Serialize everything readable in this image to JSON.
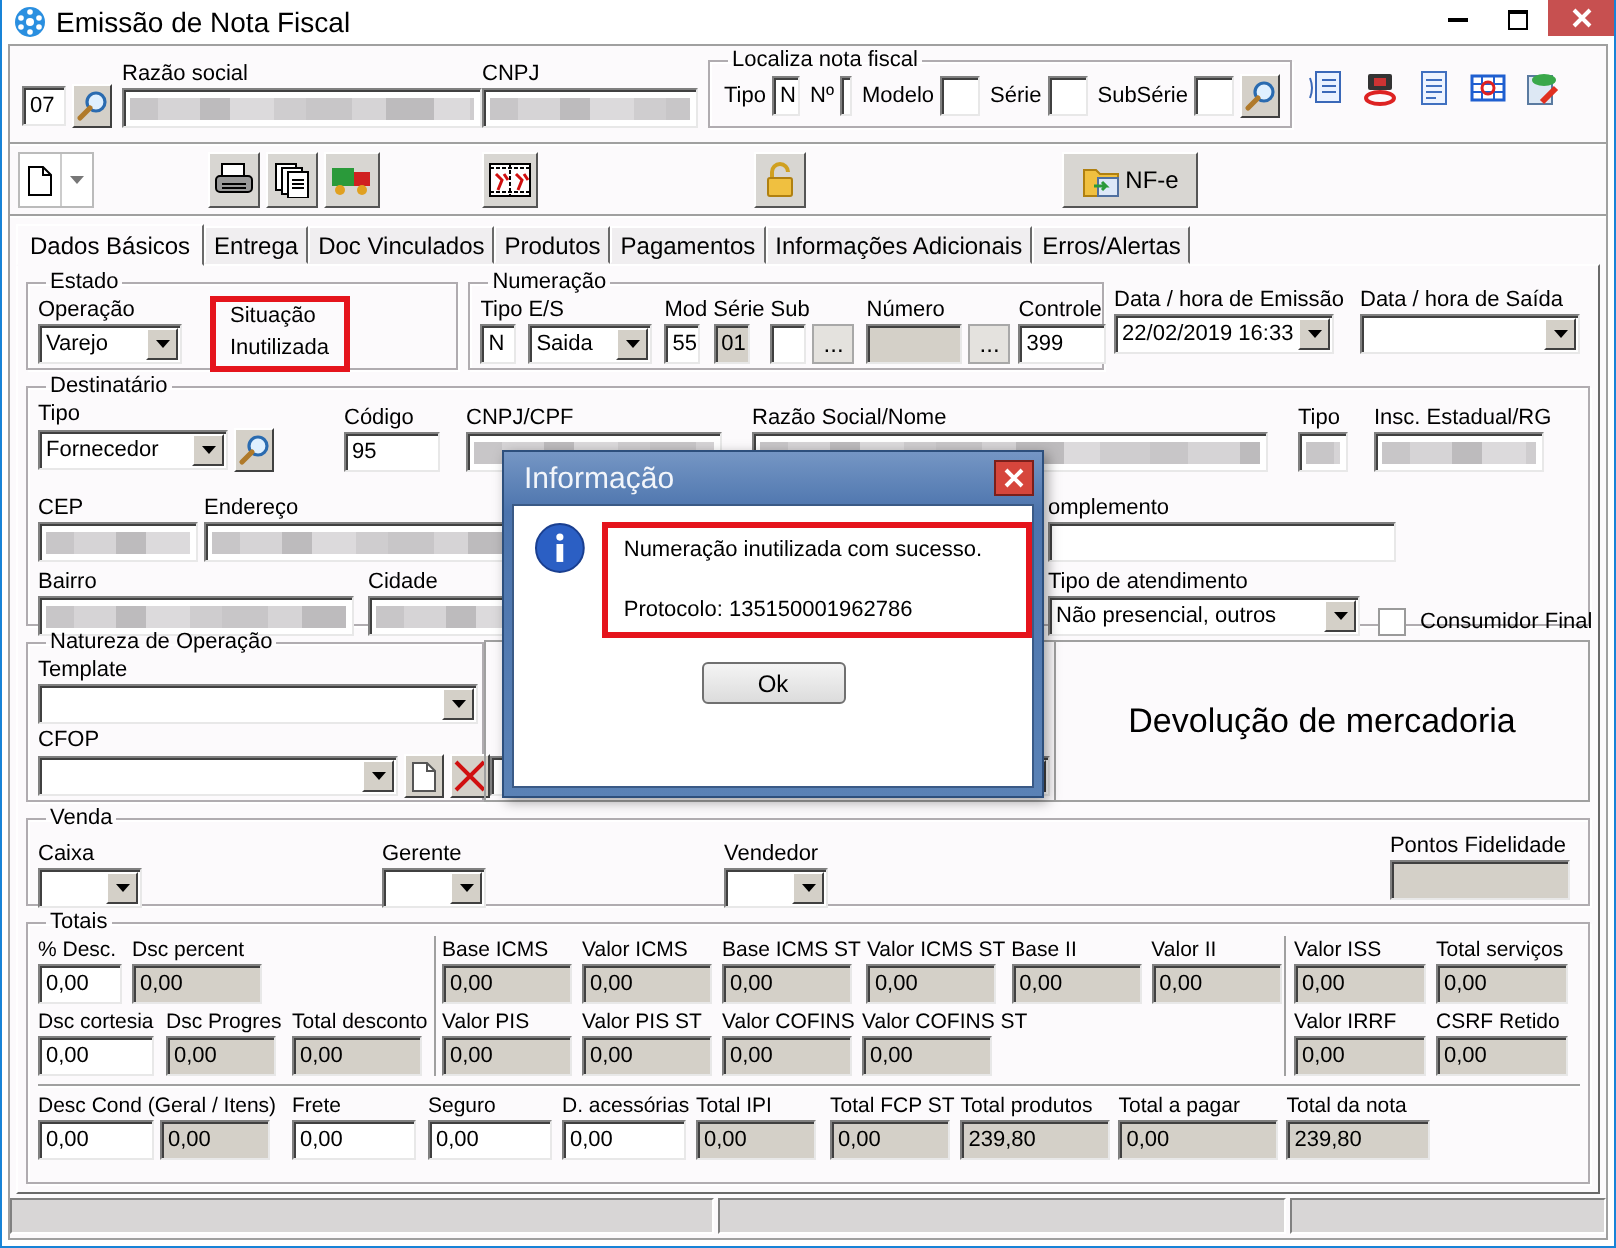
{
  "window": {
    "title": "Emissão de Nota Fiscal"
  },
  "header": {
    "fields": [
      {
        "value": "07",
        "search": true
      },
      {
        "label": "Razão social",
        "redacted": true
      },
      {
        "label": "CNPJ",
        "redacted": true
      }
    ]
  },
  "localiza": {
    "title": "Localiza nota fiscal",
    "fields": [
      {
        "label": "Tipo",
        "value": "N"
      },
      {
        "label": "Nº"
      },
      {
        "label": "Modelo"
      },
      {
        "label": "Série"
      },
      {
        "label": "SubSérie"
      }
    ]
  },
  "toolbar": {
    "nfe_label": "NF-e"
  },
  "tabs": [
    {
      "label": "Dados Básicos",
      "selected": true
    },
    {
      "label": "Entrega",
      "selected": false
    },
    {
      "label": "Doc Vinculados",
      "selected": false
    },
    {
      "label": "Produtos",
      "selected": false
    },
    {
      "label": "Pagamentos",
      "selected": false
    },
    {
      "label": "Informações Adicionais",
      "selected": false
    },
    {
      "label": "Erros/Alertas",
      "selected": false
    }
  ],
  "estado": {
    "title": "Estado",
    "operacao": {
      "label": "Operação",
      "value": "Varejo",
      "kind": "combo"
    },
    "situacao": {
      "label": "Situação",
      "value": "Inutilizada",
      "highlighted": true
    }
  },
  "numeracao": {
    "title": "Numeração",
    "fields": [
      {
        "label": "Tipo",
        "value": "N",
        "kind": "text",
        "disabled": false
      },
      {
        "label": "E/S",
        "value": "Saida",
        "kind": "combo",
        "disabled": false
      },
      {
        "label": "Mod",
        "value": "55",
        "kind": "text",
        "disabled": false
      },
      {
        "label": "Série",
        "value": "01",
        "kind": "text",
        "disabled": true
      },
      {
        "label": "Sub",
        "kind": "text",
        "disabled": false,
        "button": "..."
      },
      {
        "label": "Número",
        "kind": "text",
        "disabled": true,
        "button": "..."
      },
      {
        "label": "Controle",
        "value": "399",
        "kind": "text",
        "disabled": false
      }
    ]
  },
  "datas": [
    {
      "label": "Data / hora de Emissão",
      "value": "22/02/2019 16:33",
      "kind": "combo"
    },
    {
      "label": "Data / hora de Saída",
      "kind": "combo"
    }
  ],
  "destinatario": {
    "title": "Destinatário",
    "fields": [
      {
        "label": "Tipo",
        "value": "Fornecedor",
        "kind": "combo",
        "search": true
      },
      {
        "label": "Código",
        "value": "95",
        "kind": "text"
      },
      {
        "label": "CNPJ/CPF",
        "kind": "text",
        "redacted": true
      },
      {
        "label": "Razão Social/Nome",
        "kind": "text",
        "redacted": true
      },
      {
        "label": "Tipo",
        "kind": "text",
        "redacted": true
      },
      {
        "label": "Insc. Estadual/RG",
        "kind": "text",
        "redacted": true
      },
      {
        "label": "CEP",
        "kind": "text",
        "redacted": true
      },
      {
        "label": "Endereço",
        "kind": "text",
        "redacted": true
      },
      {
        "label": "omplemento",
        "kind": "text"
      },
      {
        "label": "Bairro",
        "kind": "text",
        "redacted": true
      },
      {
        "label": "Cidade",
        "kind": "text",
        "redacted": true
      },
      {
        "label": "Tipo de atendimento",
        "value": "Não presencial, outros",
        "kind": "combo"
      },
      {
        "label": "Consumidor Final",
        "kind": "check",
        "checked": false
      }
    ]
  },
  "natureza": {
    "title": "Natureza de Operação",
    "fields": [
      {
        "label": "Template",
        "kind": "combo"
      },
      {
        "label": "CFOP",
        "kind": "combo",
        "actions": true
      }
    ]
  },
  "operation_description": "Devolução de mercadoria",
  "venda": {
    "title": "Venda",
    "fields": [
      {
        "label": "Caixa",
        "kind": "combo",
        "disabled": false
      },
      {
        "label": "Gerente",
        "kind": "combo",
        "disabled": false
      },
      {
        "label": "Vendedor",
        "kind": "combo",
        "disabled": false
      },
      {
        "label": "Pontos Fidelidade",
        "kind": "text",
        "disabled": true
      }
    ]
  },
  "totais": {
    "title": "Totais",
    "left": [
      [
        {
          "label": "% Desc.",
          "value": "0,00",
          "disabled": false
        },
        {
          "label": "Dsc percent",
          "value": "0,00",
          "disabled": true
        }
      ],
      [
        {
          "label": "Dsc cortesia",
          "value": "0,00",
          "disabled": false
        },
        {
          "label": "Dsc Progres",
          "value": "0,00",
          "disabled": true
        },
        {
          "label": "Total desconto",
          "value": "0,00",
          "disabled": true
        }
      ]
    ],
    "middle": [
      [
        {
          "label": "Base ICMS",
          "value": "0,00",
          "disabled": true
        },
        {
          "label": "Valor ICMS",
          "value": "0,00",
          "disabled": true
        },
        {
          "label": "Base ICMS ST",
          "value": "0,00",
          "disabled": true
        },
        {
          "label": "Valor ICMS ST",
          "value": "0,00",
          "disabled": true
        },
        {
          "label": "Base II",
          "value": "0,00",
          "disabled": true
        },
        {
          "label": "Valor II",
          "value": "0,00",
          "disabled": true
        }
      ],
      [
        {
          "label": "Valor PIS",
          "value": "0,00",
          "disabled": true
        },
        {
          "label": "Valor PIS ST",
          "value": "0,00",
          "disabled": true
        },
        {
          "label": "Valor COFINS",
          "value": "0,00",
          "disabled": true
        },
        {
          "label": "Valor COFINS ST",
          "value": "0,00",
          "disabled": true
        }
      ]
    ],
    "right": [
      [
        {
          "label": "Valor ISS",
          "value": "0,00",
          "disabled": true
        },
        {
          "label": "Total serviços",
          "value": "0,00",
          "disabled": true
        }
      ],
      [
        {
          "label": "Valor IRRF",
          "value": "0,00",
          "disabled": true
        },
        {
          "label": "CSRF Retido",
          "value": "0,00",
          "disabled": true
        }
      ]
    ],
    "bottom": [
      {
        "label": "Desc Cond (Geral / Itens)",
        "value": "0,00",
        "value2": "0,00",
        "disabled": false
      },
      {
        "label": "Frete",
        "value": "0,00",
        "disabled": false
      },
      {
        "label": "Seguro",
        "value": "0,00",
        "disabled": false
      },
      {
        "label": "D. acessórias",
        "value": "0,00",
        "disabled": false
      },
      {
        "label": "Total IPI",
        "value": "0,00",
        "disabled": true
      },
      {
        "label": "Total FCP ST",
        "value": "0,00",
        "disabled": true
      },
      {
        "label": "Total produtos",
        "value": "239,80",
        "disabled": true
      },
      {
        "label": "Total a pagar",
        "value": "0,00",
        "disabled": true
      },
      {
        "label": "Total da nota",
        "value": "239,80",
        "disabled": true
      }
    ]
  },
  "dialog": {
    "title": "Informação",
    "lines": [
      "Numeração inutilizada com sucesso.",
      "Protocolo: 135150001962786"
    ],
    "highlighted": true,
    "button": "Ok"
  }
}
